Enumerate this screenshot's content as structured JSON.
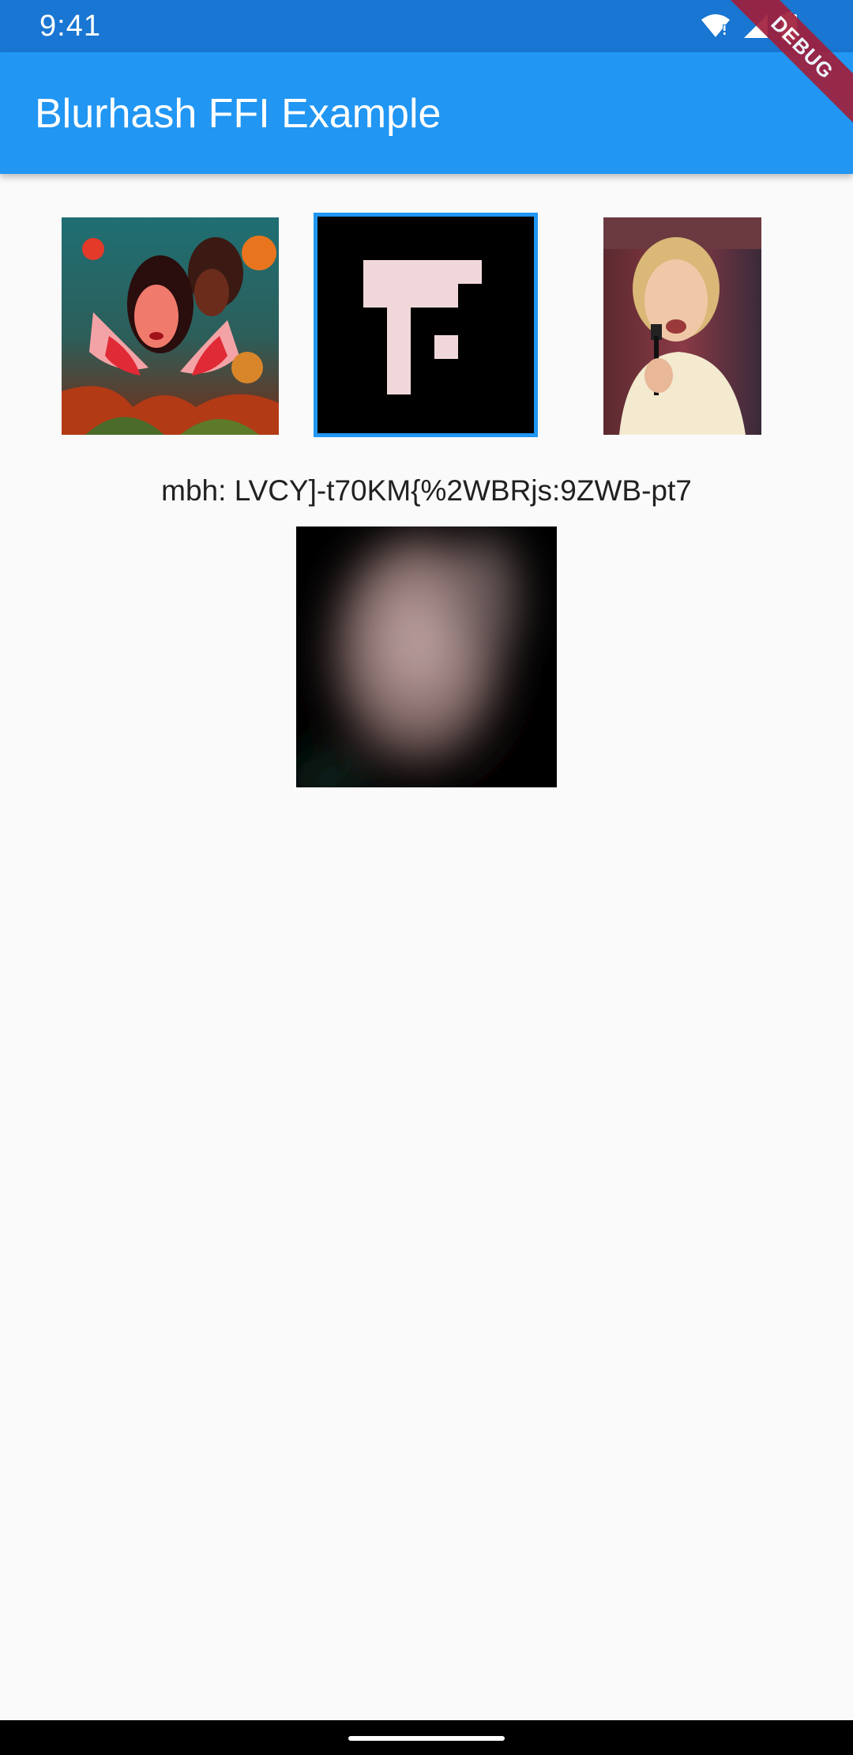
{
  "status_bar": {
    "time": "9:41",
    "icons": [
      "wifi-icon",
      "signal-icon",
      "battery-icon"
    ]
  },
  "app_bar": {
    "title": "Blurhash FFI Example",
    "color": "#2196f3"
  },
  "debug_banner": {
    "label": "DEBUG"
  },
  "images": [
    {
      "name": "illustration-thumbnail",
      "selected": false
    },
    {
      "name": "pixel-glyph-thumbnail",
      "selected": true
    },
    {
      "name": "portrait-photo-thumbnail",
      "selected": false
    }
  ],
  "hash": {
    "text": "mbh: LVCY]-t70KM{%2WBRjs:9ZWB-pt7"
  },
  "colors": {
    "status_bar": "#1976d2",
    "selection_border": "#2196f3",
    "background": "#fafafa"
  }
}
